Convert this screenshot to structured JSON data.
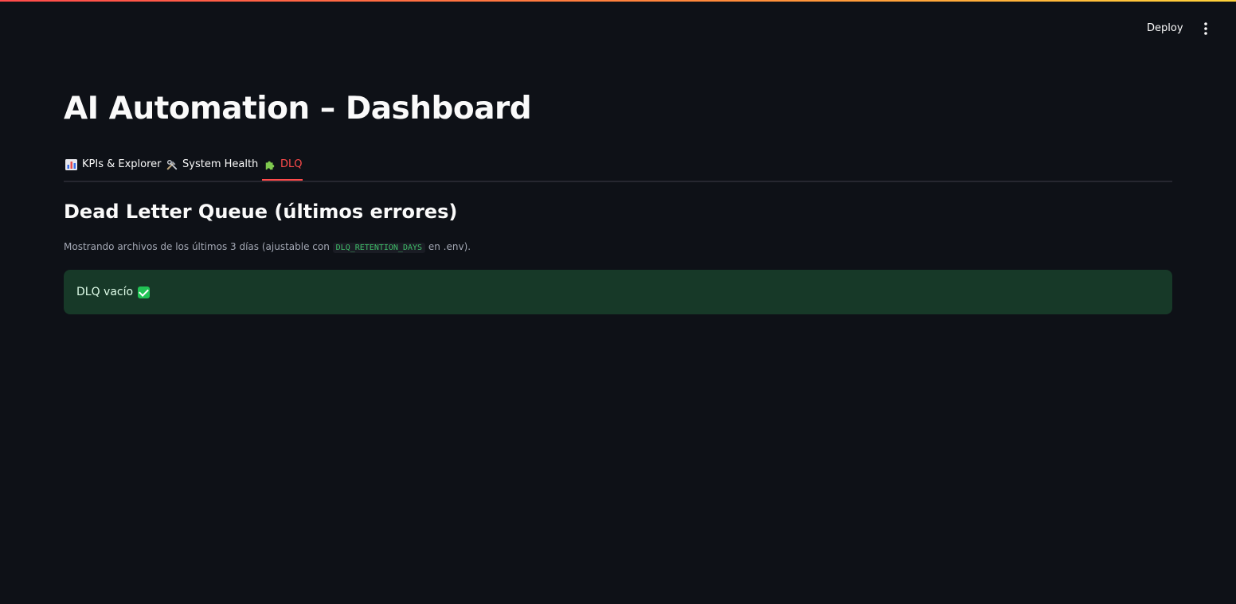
{
  "header": {
    "deploy_label": "Deploy",
    "menu_icon": "vertical-ellipsis-icon"
  },
  "page": {
    "title": "AI Automation – Dashboard"
  },
  "tabs": [
    {
      "label": "KPIs & Explorer",
      "icon": "bar-chart-icon",
      "active": false
    },
    {
      "label": "System Health",
      "icon": "tools-icon",
      "active": false
    },
    {
      "label": "DLQ",
      "icon": "puzzle-icon",
      "active": true
    }
  ],
  "dlq": {
    "heading": "Dead Letter Queue (últimos errores)",
    "caption_prefix": "Mostrando archivos de los últimos 3 días (ajustable con",
    "caption_code": "DLQ_RETENTION_DAYS",
    "caption_suffix": "en .env).",
    "status_message": "DLQ vacío",
    "status_icon": "check-mark-icon"
  },
  "colors": {
    "background": "#0e1117",
    "accent": "#ff4b4b",
    "success_bg": "#173928",
    "code_text": "#3fbd69"
  }
}
